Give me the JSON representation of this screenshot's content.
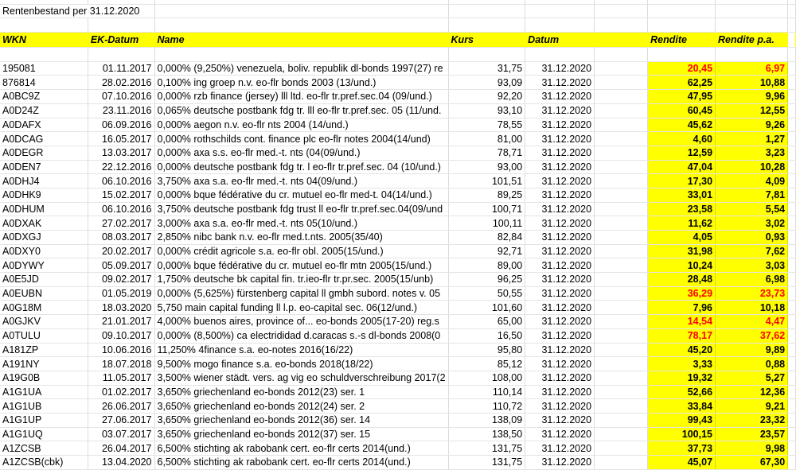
{
  "title": "Rentenbestand per 31.12.2020",
  "headers": {
    "wkn": "WKN",
    "ek_datum": "EK-Datum",
    "name": "Name",
    "kurs": "Kurs",
    "datum": "Datum",
    "rendite": "Rendite",
    "rendite_pa": "Rendite p.a."
  },
  "colors": {
    "highlight": "#ffff00",
    "negative_flag": "#ff0000"
  },
  "rows": [
    {
      "wkn": "195081",
      "ek": "01.11.2017",
      "name": "0,000% (9,250%) venezuela, boliv. republik dl-bonds 1997(27) re",
      "kurs": "31,75",
      "datum": "31.12.2020",
      "rendite": "20,45",
      "pa": "6,97",
      "red": true
    },
    {
      "wkn": "876814",
      "ek": "28.02.2016",
      "name": "0,100% ing groep n.v. eo-flr bonds 2003 (13/und.)",
      "kurs": "93,09",
      "datum": "31.12.2020",
      "rendite": "62,25",
      "pa": "10,88"
    },
    {
      "wkn": "A0BC9Z",
      "ek": "07.10.2016",
      "name": "0,000% rzb finance (jersey) lll ltd. eo-flr tr.pref.sec.04 (09/und.)",
      "kurs": "92,20",
      "datum": "31.12.2020",
      "rendite": "47,95",
      "pa": "9,96"
    },
    {
      "wkn": "A0D24Z",
      "ek": "23.11.2016",
      "name": "0,065% deutsche postbank fdg tr. lll eo-flr tr.pref.sec. 05 (11/und.",
      "kurs": "93,10",
      "datum": "31.12.2020",
      "rendite": "60,45",
      "pa": "12,55"
    },
    {
      "wkn": "A0DAFX",
      "ek": "06.09.2016",
      "name": "0,000% aegon n.v. eo-flr nts 2004 (14/und.)",
      "kurs": "78,55",
      "datum": "31.12.2020",
      "rendite": "45,62",
      "pa": "9,26"
    },
    {
      "wkn": "A0DCAG",
      "ek": "16.05.2017",
      "name": "0,000% rothschilds cont. finance plc eo-flr notes 2004(14/und)",
      "kurs": "81,00",
      "datum": "31.12.2020",
      "rendite": "4,60",
      "pa": "1,27"
    },
    {
      "wkn": "A0DEGR",
      "ek": "13.03.2017",
      "name": "0,000% axa s.s. eo-flr med.-t. nts (04(09/und.)",
      "kurs": "78,71",
      "datum": "31.12.2020",
      "rendite": "12,59",
      "pa": "3,23"
    },
    {
      "wkn": "A0DEN7",
      "ek": "22.12.2016",
      "name": "0,000% deutsche postbank fdg tr. l eo-flr tr.pref.sec. 04 (10/und.)",
      "kurs": "93,00",
      "datum": "31.12.2020",
      "rendite": "47,04",
      "pa": "10,28"
    },
    {
      "wkn": "A0DHJ4",
      "ek": "06.10.2016",
      "name": "3,750% axa s.a. eo-flr med.-t. nts 04(09/und.)",
      "kurs": "101,51",
      "datum": "31.12.2020",
      "rendite": "17,30",
      "pa": "4,09"
    },
    {
      "wkn": "A0DHK9",
      "ek": "15.02.2017",
      "name": "0,000% bque fédérative du cr. mutuel eo-flr med-t. 04(14/und.)",
      "kurs": "89,25",
      "datum": "31.12.2020",
      "rendite": "33,01",
      "pa": "7,81"
    },
    {
      "wkn": "A0DHUM",
      "ek": "06.10.2016",
      "name": "3,750% deutsche postbank fdg trust ll eo-flr tr.pref.sec.04(09/und",
      "kurs": "100,71",
      "datum": "31.12.2020",
      "rendite": "23,58",
      "pa": "5,54"
    },
    {
      "wkn": "A0DXAK",
      "ek": "27.02.2017",
      "name": "3,000% axa s.a. eo-flr med.-t. nts 05(10/und.)",
      "kurs": "100,11",
      "datum": "31.12.2020",
      "rendite": "11,62",
      "pa": "3,02"
    },
    {
      "wkn": "A0DXGJ",
      "ek": "08.03.2017",
      "name": "2,850% nibc bank n.v. eo-flr med.t.nts. 2005(35/40)",
      "kurs": "82,84",
      "datum": "31.12.2020",
      "rendite": "4,05",
      "pa": "0,93"
    },
    {
      "wkn": "A0DXY0",
      "ek": "20.02.2017",
      "name": "0,000% crédit agricole s.a. eo-flr obl. 2005(15/und.)",
      "kurs": "92,71",
      "datum": "31.12.2020",
      "rendite": "31,98",
      "pa": "7,62"
    },
    {
      "wkn": "A0DYWY",
      "ek": "05.09.2017",
      "name": "0,000% bque fédérative du cr. mutuel eo-flr mtn 2005(15/und.)",
      "kurs": "89,00",
      "datum": "31.12.2020",
      "rendite": "10,24",
      "pa": "3,03"
    },
    {
      "wkn": "A0E5JD",
      "ek": "09.02.2017",
      "name": "1,750% deutsche bk capital fin. tr.ieo-flr tr.pr.sec. 2005(15/unb)",
      "kurs": "96,25",
      "datum": "31.12.2020",
      "rendite": "28,48",
      "pa": "6,98"
    },
    {
      "wkn": "A0EUBN",
      "ek": "01.05.2019",
      "name": "0,000% (5,625%) fürstenberg capital ll gmbh subord. notes v. 05",
      "kurs": "50,55",
      "datum": "31.12.2020",
      "rendite": "36,29",
      "pa": "23,73",
      "red": true
    },
    {
      "wkn": "A0G18M",
      "ek": "18.03.2020",
      "name": "5,750 main capital funding ll l.p. eo-capital sec. 06(12/und.)",
      "kurs": "101,60",
      "datum": "31.12.2020",
      "rendite": "7,96",
      "pa": "10,18"
    },
    {
      "wkn": "A0GJKV",
      "ek": "21.01.2017",
      "name": "4,000% buenos aires, province of... eo-bonds 2005(17-20) reg.s",
      "kurs": "65,00",
      "datum": "31.12.2020",
      "rendite": "14,54",
      "pa": "4,47",
      "red": true
    },
    {
      "wkn": "A0TULU",
      "ek": "09.10.2017",
      "name": "0,000% (8,500%) ca electrididad d.caracas s.-s dl-bonds 2008(0",
      "kurs": "16,50",
      "datum": "31.12.2020",
      "rendite": "78,17",
      "pa": "37,62",
      "red": true
    },
    {
      "wkn": "A181ZP",
      "ek": "10.06.2016",
      "name": "11,250% 4finance s.a. eo-notes 2016(16/22)",
      "kurs": "95,80",
      "datum": "31.12.2020",
      "rendite": "45,20",
      "pa": "9,89"
    },
    {
      "wkn": "A191NY",
      "ek": "18.07.2018",
      "name": "9,500% mogo finance s.a. eo-bonds 2018(18/22)",
      "kurs": "85,12",
      "datum": "31.12.2020",
      "rendite": "3,33",
      "pa": "0,88"
    },
    {
      "wkn": "A19G0B",
      "ek": "11.05.2017",
      "name": "3,500% wiener städt. vers. ag vig eo schuldverschreibung 2017(2",
      "kurs": "108,00",
      "datum": "31.12.2020",
      "rendite": "19,32",
      "pa": "5,27"
    },
    {
      "wkn": "A1G1UA",
      "ek": "01.02.2017",
      "name": "3,650% griechenland eo-bonds 2012(23) ser. 1",
      "kurs": "110,14",
      "datum": "31.12.2020",
      "rendite": "52,66",
      "pa": "12,36"
    },
    {
      "wkn": "A1G1UB",
      "ek": "26.06.2017",
      "name": "3,650% griechenland eo-bonds 2012(24) ser. 2",
      "kurs": "110,72",
      "datum": "31.12.2020",
      "rendite": "33,84",
      "pa": "9,21"
    },
    {
      "wkn": "A1G1UP",
      "ek": "27.06.2017",
      "name": "3,650% griechenland eo-bonds 2012(36) ser. 14",
      "kurs": "138,09",
      "datum": "31.12.2020",
      "rendite": "99,43",
      "pa": "23,32"
    },
    {
      "wkn": "A1G1UQ",
      "ek": "03.07.2017",
      "name": "3,650% griechenland eo-bonds 2012(37) ser. 15",
      "kurs": "138,50",
      "datum": "31.12.2020",
      "rendite": "100,15",
      "pa": "23,57"
    },
    {
      "wkn": "A1ZCSB",
      "ek": "26.04.2017",
      "name": "6,500% stichting ak rabobank cert. eo-flr certs 2014(und.)",
      "kurs": "131,75",
      "datum": "31.12.2020",
      "rendite": "37,73",
      "pa": "9,98"
    },
    {
      "wkn": "A1ZCSB(cbk)",
      "ek": "13.04.2020",
      "name": "6,500% stichting ak rabobank cert. eo-flr certs 2014(und.)",
      "kurs": "131,75",
      "datum": "31.12.2020",
      "rendite": "45,07",
      "pa": "67,30"
    }
  ]
}
